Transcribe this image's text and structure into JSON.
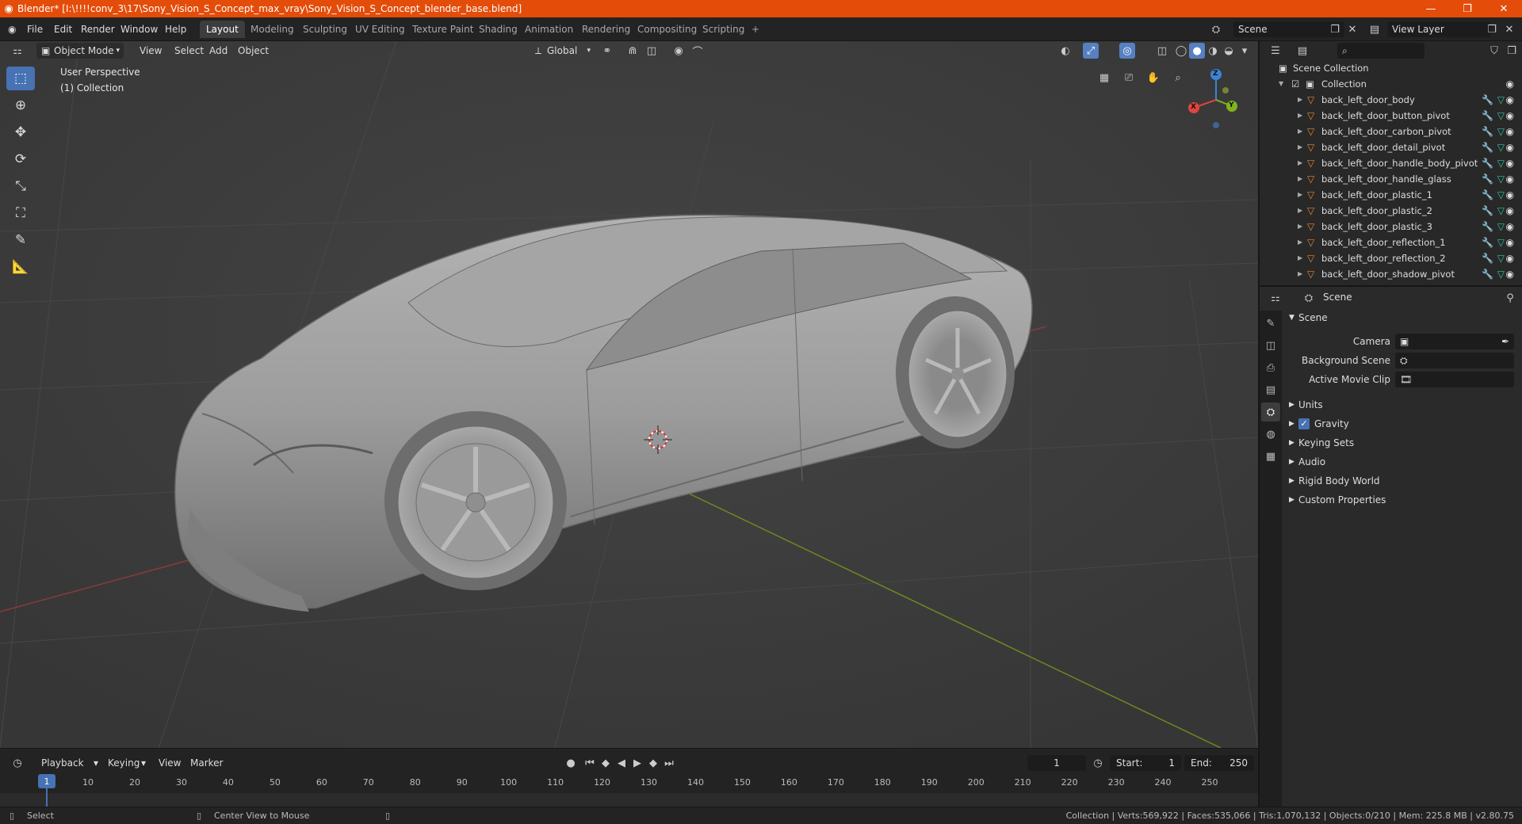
{
  "titlebar": {
    "title": "Blender* [I:\\!!!!conv_3\\17\\Sony_Vision_S_Concept_max_vray\\Sony_Vision_S_Concept_blender_base.blend]",
    "logo_icon": "blender-logo-icon"
  },
  "menu": {
    "items": [
      "File",
      "Edit",
      "Render",
      "Window",
      "Help"
    ],
    "workspaces": [
      "Layout",
      "Modeling",
      "Sculpting",
      "UV Editing",
      "Texture Paint",
      "Shading",
      "Animation",
      "Rendering",
      "Compositing",
      "Scripting"
    ],
    "active_workspace": "Layout",
    "add_tab": "+",
    "scene": "Scene",
    "view_layer": "View Layer"
  },
  "viewport": {
    "mode": "Object Mode",
    "menus": [
      "View",
      "Select",
      "Add",
      "Object"
    ],
    "orientation": "Global",
    "perspective_label": "User Perspective",
    "collection_label": "(1) Collection",
    "gizmo": {
      "x": "X",
      "y": "Y",
      "z": "Z"
    }
  },
  "timeline": {
    "menus": [
      "Playback",
      "Keying",
      "View",
      "Marker"
    ],
    "current_frame": "1",
    "start_label": "Start:",
    "start": "1",
    "end_label": "End:",
    "end": "250",
    "ticks": [
      "1",
      "10",
      "20",
      "30",
      "40",
      "50",
      "60",
      "70",
      "80",
      "90",
      "100",
      "110",
      "120",
      "130",
      "140",
      "150",
      "160",
      "170",
      "180",
      "190",
      "200",
      "210",
      "220",
      "230",
      "240",
      "250"
    ]
  },
  "statusbar": {
    "select": "Select",
    "center_view": "Center View to Mouse",
    "stats": "Collection | Verts:569,922 | Faces:535,066 | Tris:1,070,132 | Objects:0/210 | Mem: 225.8 MB | v2.80.75"
  },
  "outliner": {
    "root": "Scene Collection",
    "collection": "Collection",
    "objects": [
      "back_left_door_body",
      "back_left_door_button_pivot",
      "back_left_door_carbon_pivot",
      "back_left_door_detail_pivot",
      "back_left_door_handle_body_pivot",
      "back_left_door_handle_glass",
      "back_left_door_plastic_1",
      "back_left_door_plastic_2",
      "back_left_door_plastic_3",
      "back_left_door_reflection_1",
      "back_left_door_reflection_2",
      "back_left_door_shadow_pivot"
    ]
  },
  "properties": {
    "context": "Scene",
    "panel": "Scene",
    "camera_label": "Camera",
    "background_scene_label": "Background Scene",
    "active_movie_clip_label": "Active Movie Clip",
    "sections": [
      "Units",
      "Gravity",
      "Keying Sets",
      "Audio",
      "Rigid Body World",
      "Custom Properties"
    ],
    "gravity_checked": true
  },
  "colors": {
    "titlebar": "#e44c0a",
    "accent": "#4772b3",
    "axis_x": "#e0443e",
    "axis_y": "#7fb31e",
    "axis_z": "#3d83d9"
  }
}
